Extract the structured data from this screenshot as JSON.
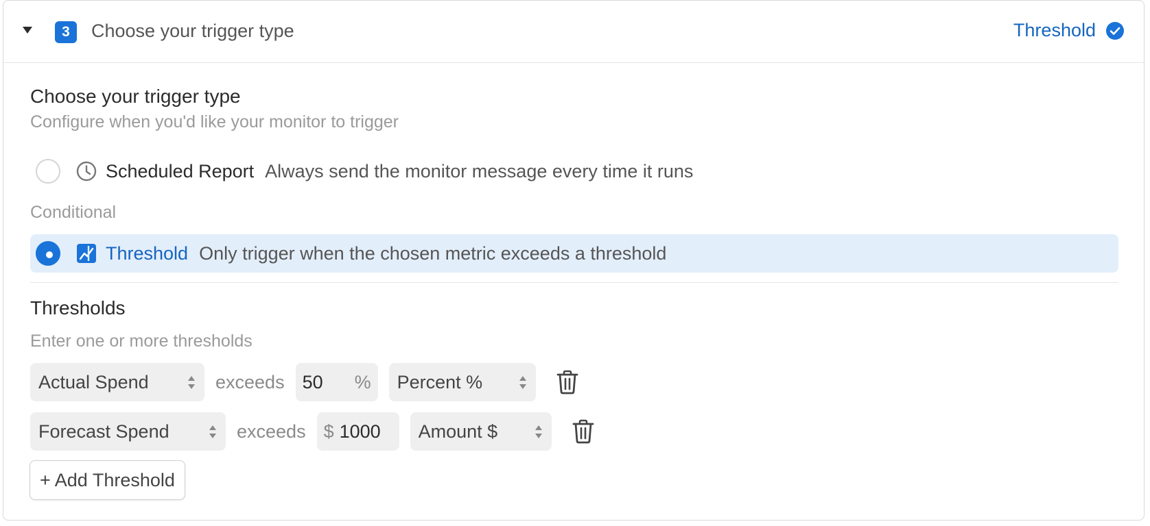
{
  "header": {
    "step_number": "3",
    "title": "Choose your trigger type",
    "status_label": "Threshold"
  },
  "trigger": {
    "title": "Choose your trigger type",
    "subtitle": "Configure when you'd like your monitor to trigger",
    "scheduled": {
      "label": "Scheduled Report",
      "description": "Always send the monitor message every time it runs",
      "selected": false
    },
    "conditional_heading": "Conditional",
    "threshold": {
      "label": "Threshold",
      "description": "Only trigger when the chosen metric exceeds a threshold",
      "selected": true
    }
  },
  "thresholds": {
    "title": "Thresholds",
    "subtitle": "Enter one or more thresholds",
    "rows": [
      {
        "metric": "Actual Spend",
        "operator": "exceeds",
        "prefix": "",
        "value": "50",
        "suffix": "%",
        "unit_type": "Percent %"
      },
      {
        "metric": "Forecast Spend",
        "operator": "exceeds",
        "prefix": "$",
        "value": "1000",
        "suffix": "",
        "unit_type": "Amount $"
      }
    ],
    "add_label": "+ Add Threshold"
  },
  "colors": {
    "accent": "#1a73d8",
    "accent_text": "#1565c0",
    "selected_bg": "#e3eefb"
  }
}
